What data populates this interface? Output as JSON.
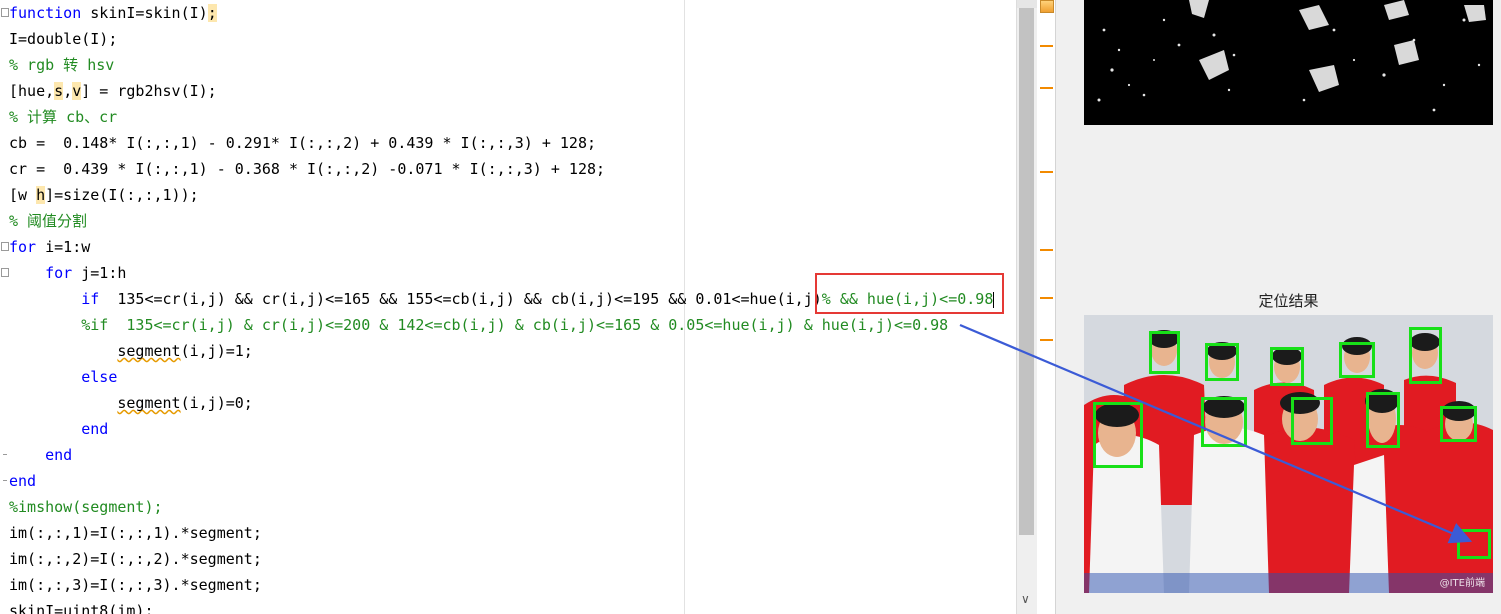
{
  "editor": {
    "lines": [
      {
        "segments": [
          {
            "cls": "kw",
            "text": "function"
          },
          {
            "text": " skinI=skin(I)"
          },
          {
            "cls": "hl",
            "text": ";"
          }
        ],
        "fold": "box"
      },
      {
        "segments": [
          {
            "text": "I=double(I);"
          }
        ],
        "fold": ""
      },
      {
        "segments": [
          {
            "cls": "cm",
            "text": "% rgb 转 hsv"
          }
        ],
        "fold": ""
      },
      {
        "segments": [
          {
            "text": "[hue,"
          },
          {
            "cls": "hl",
            "text": "s"
          },
          {
            "text": ","
          },
          {
            "cls": "hl",
            "text": "v"
          },
          {
            "text": "] = rgb2hsv(I);"
          }
        ],
        "fold": ""
      },
      {
        "segments": [
          {
            "cls": "cm",
            "text": "% 计算 cb、cr"
          }
        ],
        "fold": ""
      },
      {
        "segments": [
          {
            "text": "cb =  0.148* I(:,:,1) - 0.291* I(:,:,2) + 0.439 * I(:,:,3) + 128;"
          }
        ],
        "fold": ""
      },
      {
        "segments": [
          {
            "text": "cr =  0.439 * I(:,:,1) - 0.368 * I(:,:,2) -0.071 * I(:,:,3) + 128;"
          }
        ],
        "fold": ""
      },
      {
        "segments": [
          {
            "text": "[w "
          },
          {
            "cls": "hl",
            "text": "h"
          },
          {
            "text": "]=size(I(:,:,1));"
          }
        ],
        "fold": ""
      },
      {
        "segments": [
          {
            "cls": "cm",
            "text": "% 阈值分割"
          }
        ],
        "fold": ""
      },
      {
        "segments": [
          {
            "cls": "kw",
            "text": "for"
          },
          {
            "text": " i=1:w"
          }
        ],
        "fold": "box"
      },
      {
        "segments": [
          {
            "text": "    "
          },
          {
            "cls": "kw",
            "text": "for"
          },
          {
            "text": " j=1:h"
          }
        ],
        "fold": "box"
      },
      {
        "segments": [
          {
            "text": "        "
          },
          {
            "cls": "kw",
            "text": "if"
          },
          {
            "text": "  135<=cr(i,j) && cr(i,j)<=165 && 155<=cb(i,j) && cb(i,j)<=195 && 0.01<=hue(i,j)"
          },
          {
            "cls": "cm",
            "text": "% && hue(i,j)<=0.98"
          },
          {
            "cls": "cursor",
            "text": ""
          }
        ],
        "fold": ""
      },
      {
        "segments": [
          {
            "text": "        "
          },
          {
            "cls": "cm",
            "text": "%if  135<=cr(i,j) & cr(i,j)<=200 & 142<=cb(i,j) & cb(i,j)<=165 & 0.05<=hue(i,j) & hue(i,j)<=0.98"
          }
        ],
        "fold": ""
      },
      {
        "segments": [
          {
            "text": "            "
          },
          {
            "cls": "sq",
            "text": "segment"
          },
          {
            "text": "(i,j)=1;"
          }
        ],
        "fold": ""
      },
      {
        "segments": [
          {
            "text": "        "
          },
          {
            "cls": "kw",
            "text": "else"
          }
        ],
        "fold": ""
      },
      {
        "segments": [
          {
            "text": "            "
          },
          {
            "cls": "sq",
            "text": "segment"
          },
          {
            "text": "(i,j)=0;"
          }
        ],
        "fold": ""
      },
      {
        "segments": [
          {
            "text": "        "
          },
          {
            "cls": "kw",
            "text": "end"
          }
        ],
        "fold": ""
      },
      {
        "segments": [
          {
            "text": "    "
          },
          {
            "cls": "kw",
            "text": "end"
          }
        ],
        "fold": "tick"
      },
      {
        "segments": [
          {
            "cls": "kw",
            "text": "end"
          }
        ],
        "fold": "tick"
      },
      {
        "segments": [
          {
            "cls": "cm",
            "text": "%imshow(segment);"
          }
        ],
        "fold": ""
      },
      {
        "segments": [
          {
            "text": "im(:,:,1)=I(:,:,1).*segment;"
          }
        ],
        "fold": ""
      },
      {
        "segments": [
          {
            "text": "im(:,:,2)=I(:,:,2).*segment;"
          }
        ],
        "fold": ""
      },
      {
        "segments": [
          {
            "text": "im(:,:,3)=I(:,:,3).*segment;"
          }
        ],
        "fold": ""
      },
      {
        "segments": [
          {
            "text": "skinI=uint8(im);"
          }
        ],
        "fold": ""
      }
    ]
  },
  "scrollbar": {
    "down_icon": "chevron-down-icon",
    "down_glyph": "∨"
  },
  "markers": {
    "warning_icon": "warning-icon",
    "count": 6
  },
  "figure": {
    "title": "定位结果",
    "watermark": "@ITE前端",
    "face_box_color": "#18e018",
    "annotation_color": "#e53935",
    "arrow_color": "#3b5bd6"
  }
}
